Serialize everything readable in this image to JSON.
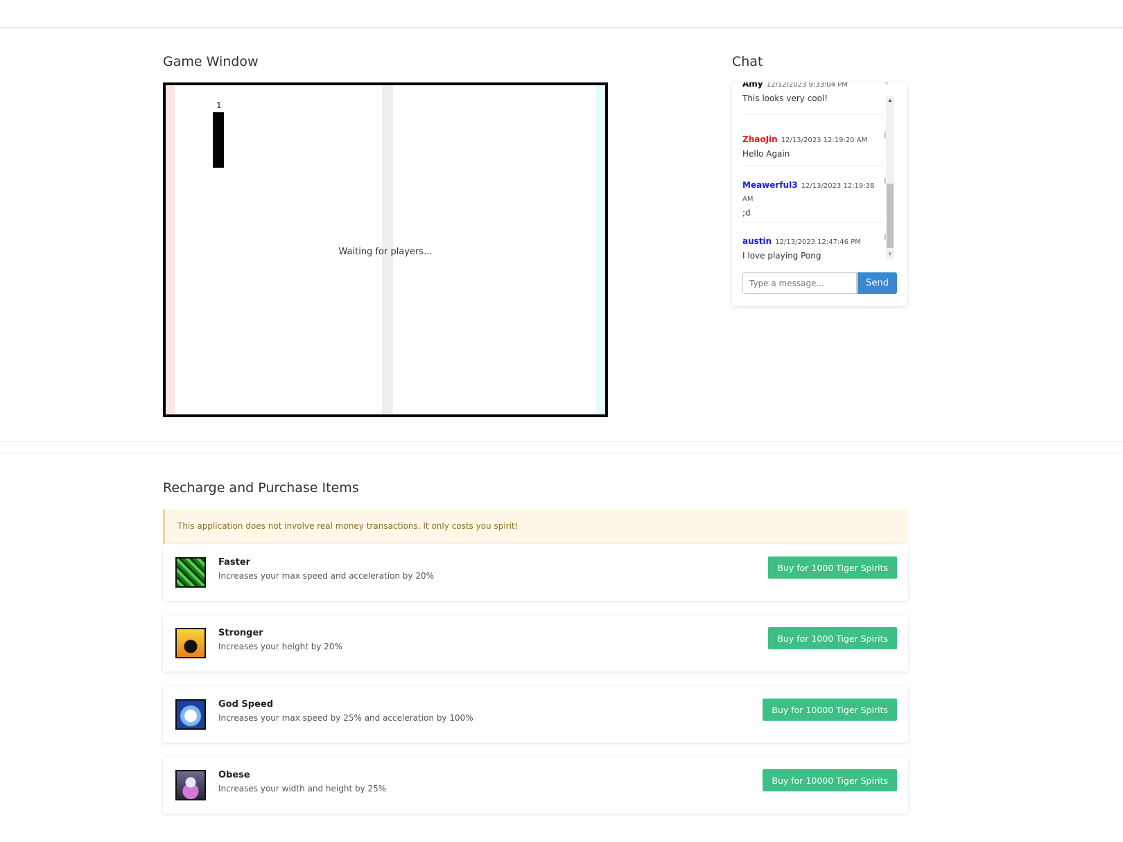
{
  "game": {
    "title": "Game Window",
    "score": "1",
    "status": "Waiting for players..."
  },
  "chat": {
    "title": "Chat",
    "messages": [
      {
        "user": "Amy",
        "user_color": "#000000",
        "time": "12/12/2023 9:33:04 PM",
        "text": "This looks very cool!"
      },
      {
        "user": "ZhaoJin",
        "user_color": "#e02020",
        "time": "12/13/2023 12:19:20 AM",
        "text": "Hello Again"
      },
      {
        "user": "Meawerful3",
        "user_color": "#1a20e0",
        "time": "12/13/2023 12:19:38 AM",
        "text": ";d"
      },
      {
        "user": "austin",
        "user_color": "#1a20e0",
        "time": "12/13/2023 12:47:46 PM",
        "text": "I love playing Pong"
      }
    ],
    "input_placeholder": "Type a message...",
    "send_label": "Send"
  },
  "shop": {
    "title": "Recharge and Purchase Items",
    "notice": "This application does not involve real money transactions. It only costs you spirit!",
    "items": [
      {
        "name": "Faster",
        "description": "Increases your max speed and acceleration by 20%",
        "button": "Buy for 1000 Tiger Spirits",
        "icon": "green-runner-icon"
      },
      {
        "name": "Stronger",
        "description": "Increases your height by 20%",
        "button": "Buy for 1000 Tiger Spirits",
        "icon": "flame-strength-icon"
      },
      {
        "name": "God Speed",
        "description": "Increases your max speed by 25% and acceleration by 100%",
        "button": "Buy for 10000 Tiger Spirits",
        "icon": "blue-burst-icon"
      },
      {
        "name": "Obese",
        "description": "Increases your width and height by 25%",
        "button": "Buy for 10000 Tiger Spirits",
        "icon": "pink-figure-icon"
      }
    ]
  }
}
